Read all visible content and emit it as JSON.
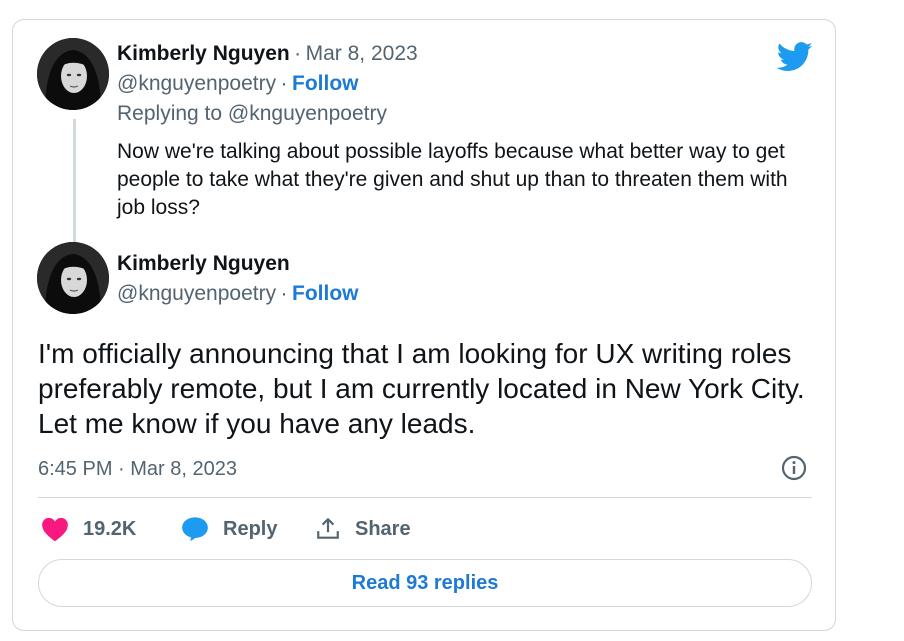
{
  "reply_tweet": {
    "author_name": "Kimberly Nguyen",
    "separator": "·",
    "date": "Mar 8, 2023",
    "handle": "@knguyenpoetry",
    "follow_label": "Follow",
    "replying_to": "Replying to @knguyenpoetry",
    "text": "Now we're talking about possible layoffs because what better way to get people to take what they're given and shut up than to threaten them with job loss?"
  },
  "main_tweet": {
    "author_name": "Kimberly Nguyen",
    "handle": "@knguyenpoetry",
    "separator": "·",
    "follow_label": "Follow",
    "text": "I'm officially announcing that I am looking for UX writing roles preferably remote, but I am currently located in New York City. Let me know if you have any leads.",
    "timestamp": "6:45 PM · Mar 8, 2023"
  },
  "actions": {
    "like_count": "19.2K",
    "reply_label": "Reply",
    "share_label": "Share"
  },
  "read_replies_label": "Read 93 replies",
  "icons": {
    "brand": "twitter-bird-icon",
    "info": "info-icon",
    "like": "heart-icon",
    "reply": "speech-bubble-icon",
    "share": "share-upload-icon"
  },
  "colors": {
    "brand_blue": "#1d9bf0",
    "link_blue": "#1d7ad6",
    "like_pink": "#f91880",
    "muted_text": "#536471",
    "border": "#cfd9de"
  }
}
